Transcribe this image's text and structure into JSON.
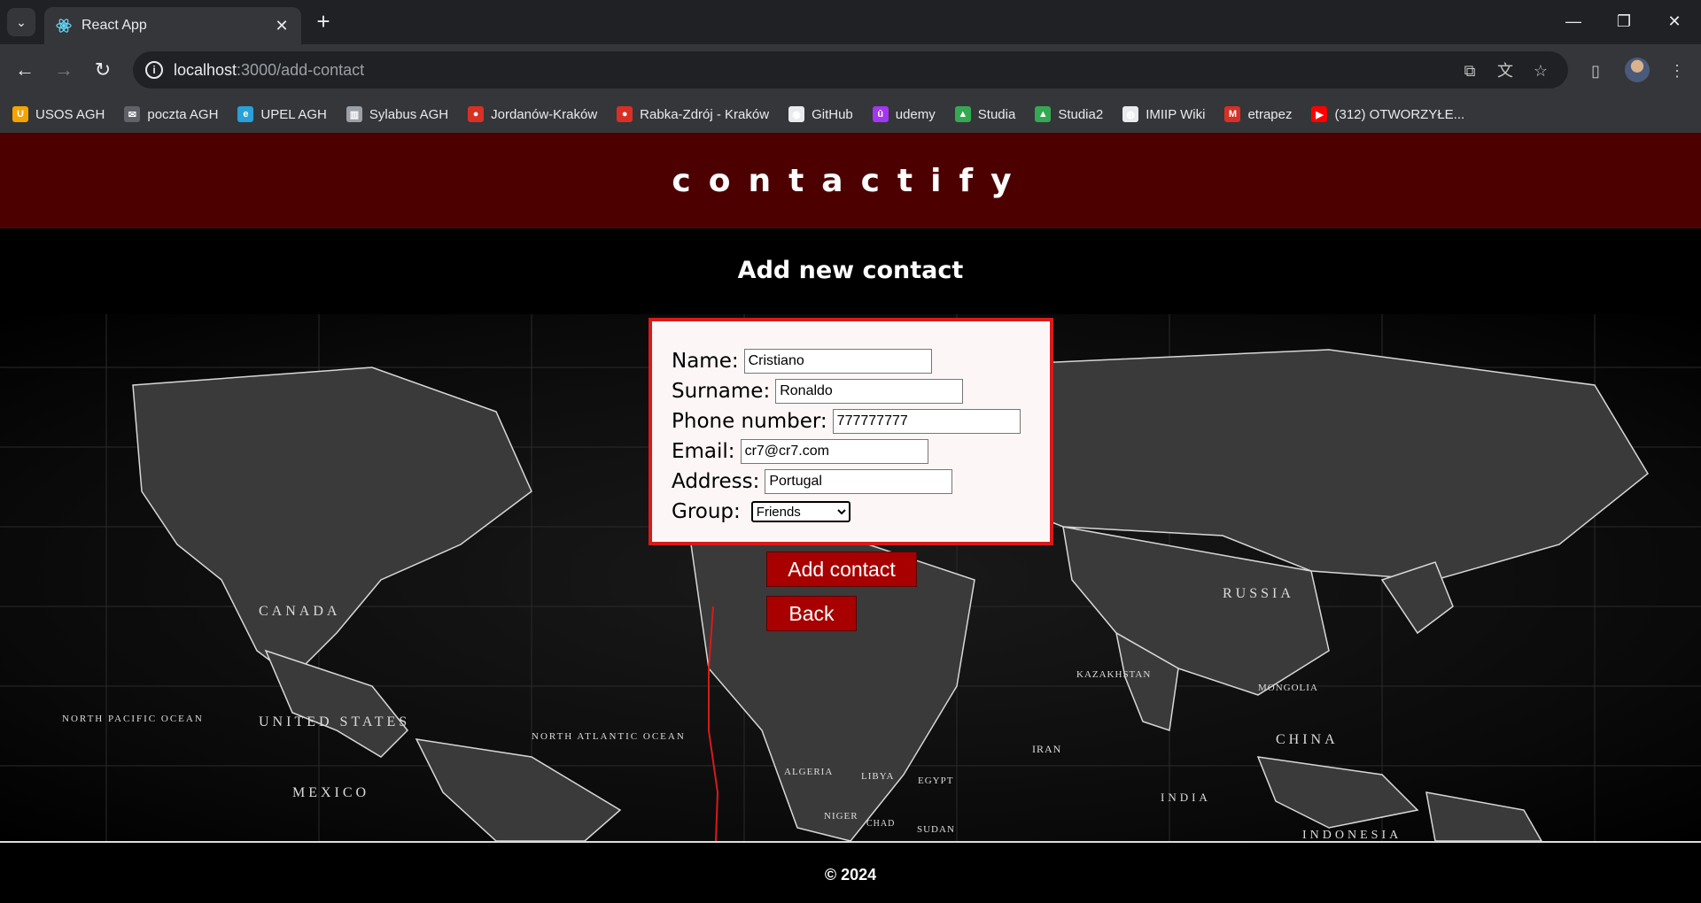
{
  "browser": {
    "tab_title": "React App",
    "url_host": "localhost",
    "url_path": ":3000/add-contact",
    "bookmarks": [
      {
        "label": "USOS AGH",
        "icon": "usos-icon",
        "color": "#f4a300"
      },
      {
        "label": "poczta AGH",
        "icon": "mail-icon",
        "color": "#5f6368"
      },
      {
        "label": "UPEL AGH",
        "icon": "upel-icon",
        "color": "#2aa0d8"
      },
      {
        "label": "Sylabus AGH",
        "icon": "book-icon",
        "color": "#9aa0a6"
      },
      {
        "label": "Jordanów-Kraków",
        "icon": "bus-icon",
        "color": "#d93025"
      },
      {
        "label": "Rabka-Zdrój - Kraków",
        "icon": "bus-icon",
        "color": "#d93025"
      },
      {
        "label": "GitHub",
        "icon": "github-icon",
        "color": "#e8eaed"
      },
      {
        "label": "udemy",
        "icon": "udemy-icon",
        "color": "#a435f0"
      },
      {
        "label": "Studia",
        "icon": "drive-icon",
        "color": "#34a853"
      },
      {
        "label": "Studia2",
        "icon": "drive-icon",
        "color": "#34a853"
      },
      {
        "label": "IMIIP Wiki",
        "icon": "globe-icon",
        "color": "#e8eaed"
      },
      {
        "label": "etrapez",
        "icon": "etrapez-icon",
        "color": "#d93025"
      },
      {
        "label": "(312) OTWORZYŁE...",
        "icon": "youtube-icon",
        "color": "#ff0000"
      }
    ]
  },
  "page": {
    "brand": "contactify",
    "heading": "Add new contact",
    "form": {
      "name_label": "Name:",
      "name_value": "Cristiano",
      "surname_label": "Surname:",
      "surname_value": "Ronaldo",
      "phone_label": "Phone number:",
      "phone_value": "777777777",
      "email_label": "Email:",
      "email_value": "cr7@cr7.com",
      "address_label": "Address:",
      "address_value": "Portugal",
      "group_label": "Group:",
      "group_value": "Friends"
    },
    "add_button": "Add contact",
    "back_button": "Back",
    "footer": "© 2024"
  },
  "map_labels": [
    "CANADA",
    "UNITED STATES",
    "MEXICO",
    "RUSSIA",
    "KAZAKHSTAN",
    "MONGOLIA",
    "CHINA",
    "INDIA",
    "IRAN",
    "ALGERIA",
    "LIBYA",
    "EGYPT",
    "NIGER",
    "CHAD",
    "SUDAN",
    "INDONESIA",
    "NORTH PACIFIC OCEAN",
    "NORTH ATLANTIC OCEAN"
  ],
  "colors": {
    "header_bg": "#4d0000",
    "button_bg": "#a80000",
    "card_border": "#d91a1a"
  }
}
